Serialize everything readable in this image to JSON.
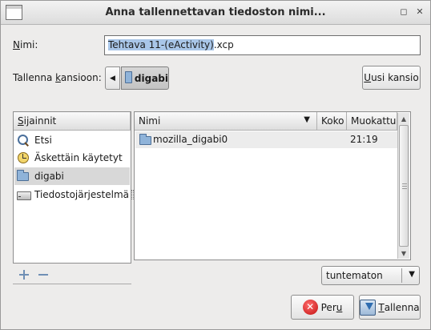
{
  "window": {
    "title": "Anna tallennettavan tiedoston nimi..."
  },
  "name_field": {
    "label_accel": "N",
    "label_rest": "imi:",
    "value_selected": "Tehtava 11-(eActivity)",
    "value_rest": ".xcp"
  },
  "save_in": {
    "label_pre": "Tallenna ",
    "label_accel": "k",
    "label_post": "ansioon:",
    "current_folder": "digabi"
  },
  "new_folder_button": {
    "accel": "U",
    "rest": "usi kansio"
  },
  "places": {
    "header_accel": "S",
    "header_rest": "ijainnit",
    "items": [
      {
        "label": "Etsi",
        "icon": "search-icon"
      },
      {
        "label": "Äskettäin käytetyt",
        "icon": "recent-clock-icon"
      },
      {
        "label": "digabi",
        "icon": "folder-icon"
      },
      {
        "label": "Tiedostojärjestelmä",
        "icon": "drive-icon"
      }
    ]
  },
  "files": {
    "columns": {
      "name": "Nimi",
      "size": "Koko",
      "modified": "Muokattu"
    },
    "rows": [
      {
        "name": "mozilla_digabi0",
        "size": "",
        "modified": "21:19",
        "icon": "folder-icon"
      }
    ]
  },
  "filter": {
    "selected": "tuntematon"
  },
  "buttons": {
    "cancel_pre": "Per",
    "cancel_accel": "u",
    "save_accel": "T",
    "save_rest": "allenna"
  }
}
